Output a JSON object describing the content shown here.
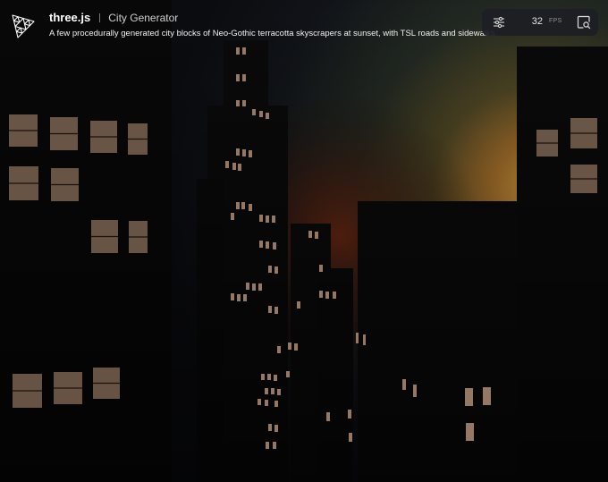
{
  "app": {
    "brand_name": "three.js",
    "title": "City Generator",
    "description": "A few procedurally generated city blocks of Neo-Gothic terracotta skyscrapers at sunset, with TSL roads and sidewalks."
  },
  "toolbar": {
    "settings_icon": "sliders-icon",
    "fps_value": "32",
    "fps_label": "FPS",
    "inspect_icon": "inspect-icon"
  },
  "colors": {
    "sky_top": "#101216",
    "sky_glow": "#c98c3a",
    "horizon_red": "#7a2a10",
    "window_light": "#b8957a",
    "building": "#080808"
  }
}
